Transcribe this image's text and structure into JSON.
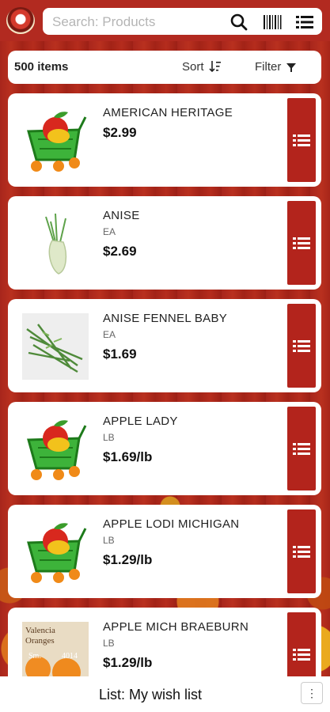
{
  "header": {
    "search_placeholder": "Search: Products",
    "icons": [
      "search-icon",
      "barcode-icon",
      "list-icon"
    ]
  },
  "toolbar": {
    "count": "500 items",
    "sort_label": "Sort",
    "filter_label": "Filter"
  },
  "products": [
    {
      "name": "AMERICAN HERITAGE",
      "unit": "",
      "price": "$2.99",
      "image": "cart-placeholder"
    },
    {
      "name": "ANISE",
      "unit": "EA",
      "price": "$2.69",
      "image": "fennel-photo"
    },
    {
      "name": "ANISE FENNEL BABY",
      "unit": "EA",
      "price": "$1.69",
      "image": "fennel-bunch-photo"
    },
    {
      "name": "APPLE LADY",
      "unit": "LB",
      "price": "$1.69/lb",
      "image": "cart-placeholder"
    },
    {
      "name": "APPLE LODI MICHIGAN",
      "unit": "LB",
      "price": "$1.29/lb",
      "image": "cart-placeholder"
    },
    {
      "name": "APPLE MICH BRAEBURN",
      "unit": "LB",
      "price": "$1.29/lb",
      "image": "oranges-sign-photo"
    }
  ],
  "oranges_sign": {
    "line1": "Valencia",
    "line2": "Oranges",
    "code_left": "Sm.",
    "code_right": "4014"
  },
  "footer": {
    "list_label": "List: My wish list",
    "more_glyph": "⋮"
  },
  "colors": {
    "accent": "#b3241c",
    "header": "#b22a20"
  }
}
